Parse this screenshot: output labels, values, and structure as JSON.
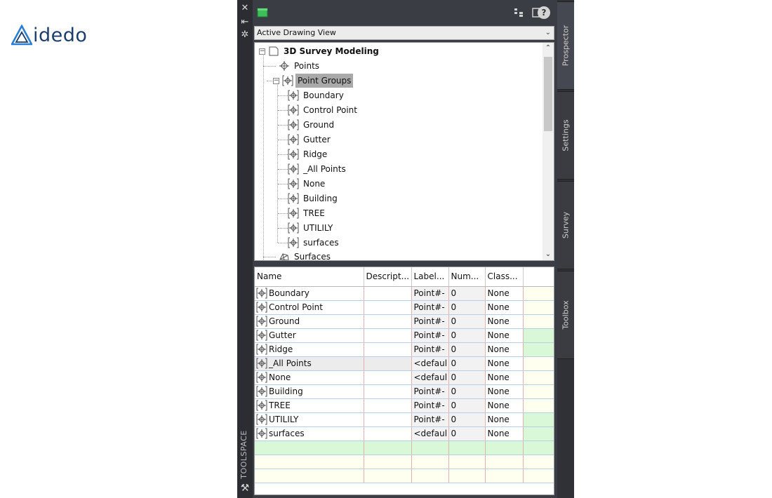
{
  "logo": {
    "text": "idedo"
  },
  "toolspace": {
    "vertical_title": "TOOLSPACE",
    "dropdown_value": "Active Drawing View",
    "side_tabs": [
      "Prospector",
      "Settings",
      "Survey",
      "Toolbox"
    ],
    "help_label": "?"
  },
  "tree": {
    "root": "3D Survey Modeling",
    "points": "Points",
    "point_groups": "Point Groups",
    "groups": [
      "Boundary",
      "Control Point",
      "Ground",
      "Gutter",
      "Ridge",
      "_All Points",
      "None",
      "Building",
      "TREE",
      "UTILILY",
      "surfaces"
    ],
    "surfaces": "Surfaces"
  },
  "grid": {
    "headers": [
      "Name",
      "Descript...",
      "Label...",
      "Num...",
      "Class..."
    ],
    "rows": [
      {
        "name": "Boundary",
        "desc": "",
        "label": "Point#-",
        "num": "0",
        "class": "None",
        "flag": "y"
      },
      {
        "name": "Control Point",
        "desc": "",
        "label": "Point#-",
        "num": "0",
        "class": "None",
        "flag": "y"
      },
      {
        "name": "Ground",
        "desc": "",
        "label": "Point#-",
        "num": "0",
        "class": "None",
        "flag": "y"
      },
      {
        "name": "Gutter",
        "desc": "",
        "label": "Point#-",
        "num": "0",
        "class": "None",
        "flag": "g"
      },
      {
        "name": "Ridge",
        "desc": "",
        "label": "Point#-",
        "num": "0",
        "class": "None",
        "flag": "g"
      },
      {
        "name": "_All Points",
        "desc": "",
        "label": "<defaul",
        "num": "0",
        "class": "None",
        "flag": "y"
      },
      {
        "name": "None",
        "desc": "",
        "label": "<defaul",
        "num": "0",
        "class": "None",
        "flag": "y"
      },
      {
        "name": "Building",
        "desc": "",
        "label": "Point#-",
        "num": "0",
        "class": "None",
        "flag": "y"
      },
      {
        "name": "TREE",
        "desc": "",
        "label": "Point#-",
        "num": "0",
        "class": "None",
        "flag": "y"
      },
      {
        "name": "UTILILY",
        "desc": "",
        "label": "Point#-",
        "num": "0",
        "class": "None",
        "flag": "g"
      },
      {
        "name": "surfaces",
        "desc": "",
        "label": "<defaul",
        "num": "0",
        "class": "None",
        "flag": "g"
      }
    ],
    "empty_rows": [
      "g",
      "y",
      "y"
    ]
  },
  "colors": {
    "row_yellow": "#fffff0",
    "row_green": "#d8f8d8",
    "selected": "#a9a9a9",
    "logo_blue": "#1c3f6e",
    "logo_accent": "#2a7fd4"
  },
  "icons": [
    "close-icon",
    "pin-icon",
    "settings-icon",
    "point-group-icon",
    "point-icon",
    "surface-icon",
    "drawing-icon",
    "layout-icon",
    "panel-icon",
    "help-icon",
    "wrench-icon"
  ]
}
